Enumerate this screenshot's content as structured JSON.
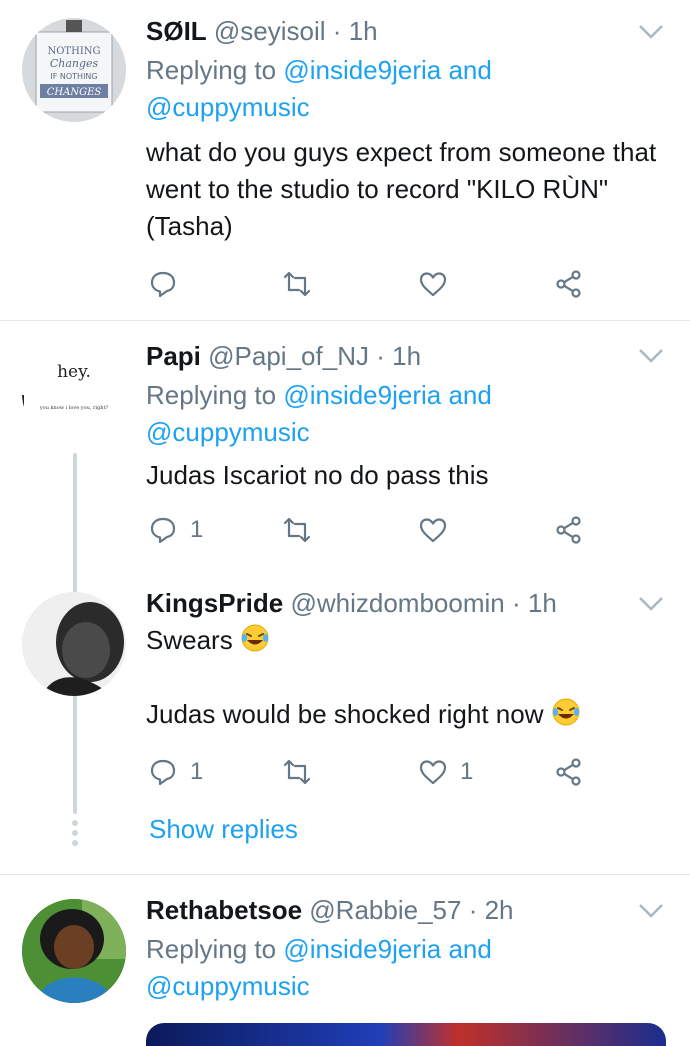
{
  "tweets": [
    {
      "name": "SØIL",
      "handle": "@seyisoil",
      "time": "1h",
      "replying_prefix": "Replying to",
      "replying_to_1": "@inside9jeria",
      "replying_and": "and",
      "replying_to_2": "@cuppymusic",
      "text": "what do you guys expect from someone that went to the studio to record \"KILO RÙN\"(Tasha)",
      "avatar_text": [
        "NOTHING",
        "Changes",
        "IF NOTHING",
        "CHANGES"
      ],
      "reply_count": "",
      "like_count": ""
    },
    {
      "name": "Papi",
      "handle": "@Papi_of_NJ",
      "time": "1h",
      "replying_prefix": "Replying to",
      "replying_to_1": "@inside9jeria",
      "replying_and": "and",
      "replying_to_2": "@cuppymusic",
      "text": "Judas Iscariot no do pass this",
      "avatar_text": [
        "hey.",
        "you know i love you, right?"
      ],
      "reply_count": "1",
      "like_count": ""
    },
    {
      "name": "KingsPride",
      "handle": "@whizdomboomin",
      "time": "1h",
      "text_line1": "Swears",
      "text_line2": "Judas would be shocked right now",
      "reply_count": "1",
      "like_count": "1",
      "show_replies": "Show replies"
    },
    {
      "name": "Rethabetsoe",
      "handle": "@Rabbie_57",
      "time": "2h",
      "replying_prefix": "Replying to",
      "replying_to_1": "@inside9jeria",
      "replying_and": "and",
      "replying_to_2": "@cuppymusic"
    }
  ],
  "colors": {
    "link": "#1da1f2",
    "muted": "#657786",
    "text": "#14171a",
    "divider": "#e1e8ed"
  },
  "icons": [
    "reply-icon",
    "retweet-icon",
    "like-icon",
    "share-icon",
    "chevron-down-icon",
    "laughing-emoji"
  ]
}
